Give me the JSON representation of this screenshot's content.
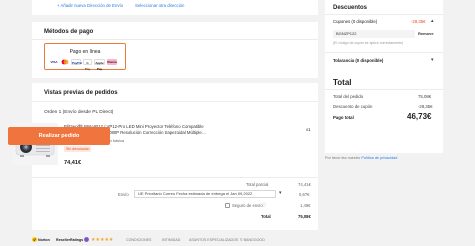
{
  "address": {
    "add_link": "+ Añadir nueva Dirección de Envío",
    "select_link": "Seleccionar otra dirección"
  },
  "payment": {
    "title": "Métodos de pago",
    "method_label": "Pago en línea",
    "logos": [
      "VISA",
      "MC",
      "PayPal",
      "G Pay",
      "Apple Pay",
      "Klarna"
    ]
  },
  "orders": {
    "title": "Vistas previas de pedidos",
    "order_label": "Orden 1 (Envío desde PL Direct)",
    "product": {
      "name_line1": "Blitzwolf® BW-VP12 / VP12-Pro LED Mini Proyector Teléfono Compatible",
      "name_line2": "con la misma pantalla 1080P Resolución Corrección trapezoidal Múltiple…",
      "variant_label": "Enchufe:",
      "variant_value": "EU",
      "type_label": "Tipo:",
      "type_value": "Versión básica",
      "badge": "Sin devolución",
      "price": "74,41€",
      "qty": "x1"
    },
    "summary": {
      "total_parcial_label": "Total parcial",
      "total_parcial_value": "74,41€",
      "envio_label": "Envío",
      "envio_option": "UE Prioritario Correo Fecha estimada de entrega el Jan 09,2022",
      "envio_value": "0,67€",
      "seguro_label": "Seguro de envío",
      "seguro_value": "1,49€",
      "total_label": "Total",
      "total_value": "75,08€"
    }
  },
  "discounts": {
    "title": "Descuentos",
    "cupones_label": "Cupones (0 disponible)",
    "cupones_value": "-28,35€",
    "coupon_code": "BGNZP122",
    "remove_label": "Remove",
    "hint": "(El código de cupón se aplicó correctamente)",
    "tolarancia_label": "Tolarancia (0 disponible)"
  },
  "totals": {
    "title": "Total",
    "rows": [
      {
        "label": "Total del pedido",
        "value": "75,08€"
      },
      {
        "label": "Descuento de cupón",
        "value": "-28,35€"
      }
    ],
    "pay_label": "Pago total",
    "pay_value": "46,73€",
    "place_button": "Realizar pedido",
    "note_prefix": "Por favor lea nuestro",
    "note_link": "Política de privacidad"
  },
  "footer": {
    "norton": "Norton",
    "reseller": "ResellerRatings",
    "stars": "★★★★★",
    "items": [
      "CONDICIONES",
      "INTIMIDAD",
      "ASUNTOS ESPECIALIZADOS",
      "© BANGGOOD"
    ]
  },
  "colors": {
    "accent": "#f0743e",
    "link": "#2a7ae2",
    "discount": "#e44d26"
  }
}
